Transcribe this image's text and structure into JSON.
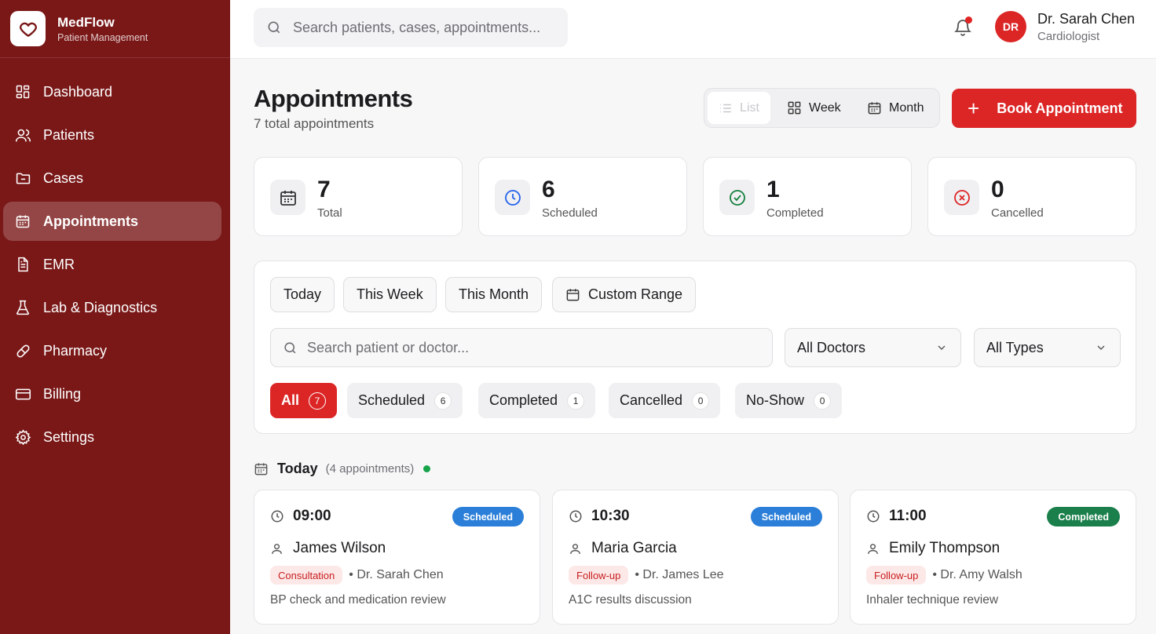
{
  "brand": {
    "name": "MedFlow",
    "subtitle": "Patient Management"
  },
  "sidebar": {
    "items": [
      {
        "label": "Dashboard",
        "icon": "dashboard-icon"
      },
      {
        "label": "Patients",
        "icon": "users-icon"
      },
      {
        "label": "Cases",
        "icon": "folder-icon"
      },
      {
        "label": "Appointments",
        "icon": "calendar-icon",
        "active": true
      },
      {
        "label": "EMR",
        "icon": "document-icon"
      },
      {
        "label": "Lab & Diagnostics",
        "icon": "flask-icon"
      },
      {
        "label": "Pharmacy",
        "icon": "pill-icon"
      },
      {
        "label": "Billing",
        "icon": "credit-card-icon"
      },
      {
        "label": "Settings",
        "icon": "gear-icon"
      }
    ]
  },
  "topbar": {
    "search_placeholder": "Search patients, cases, appointments...",
    "user": {
      "initials": "DR",
      "name": "Dr. Sarah Chen",
      "role": "Cardiologist"
    }
  },
  "header": {
    "title": "Appointments",
    "subtitle": "7 total appointments",
    "views": {
      "list": "List",
      "week": "Week",
      "month": "Month",
      "selected": "List"
    },
    "book_label": "Book Appointment"
  },
  "stats": [
    {
      "value": "7",
      "label": "Total",
      "icon": "calendar-icon",
      "color": "#333333"
    },
    {
      "value": "6",
      "label": "Scheduled",
      "icon": "clock-icon",
      "color": "#2563eb"
    },
    {
      "value": "1",
      "label": "Completed",
      "icon": "check-circle-icon",
      "color": "#15803d"
    },
    {
      "value": "0",
      "label": "Cancelled",
      "icon": "x-circle-icon",
      "color": "#dc2626"
    }
  ],
  "filters": {
    "ranges": [
      "Today",
      "This Week",
      "This Month",
      "Custom Range"
    ],
    "search_placeholder": "Search patient or doctor...",
    "doctor_select": "All Doctors",
    "type_select": "All Types",
    "statuses": [
      {
        "label": "All",
        "count": "7",
        "active": true
      },
      {
        "label": "Scheduled",
        "count": "6"
      },
      {
        "label": "Completed",
        "count": "1"
      },
      {
        "label": "Cancelled",
        "count": "0"
      },
      {
        "label": "No-Show",
        "count": "0"
      }
    ]
  },
  "today": {
    "label": "Today",
    "count": "(4 appointments)"
  },
  "appointments": [
    {
      "time": "09:00",
      "status": "Scheduled",
      "status_color": "#2b7fd9",
      "patient": "James Wilson",
      "type": "Consultation",
      "doctor": "• Dr. Sarah Chen",
      "note": "BP check and medication review"
    },
    {
      "time": "10:30",
      "status": "Scheduled",
      "status_color": "#2b7fd9",
      "patient": "Maria Garcia",
      "type": "Follow-up",
      "doctor": "• Dr. James Lee",
      "note": "A1C results discussion"
    },
    {
      "time": "11:00",
      "status": "Completed",
      "status_color": "#1a7f4b",
      "patient": "Emily Thompson",
      "type": "Follow-up",
      "doctor": "• Dr. Amy Walsh",
      "note": "Inhaler technique review"
    }
  ],
  "colors": {
    "sidebar": "#7a1818",
    "accent": "#dc2626"
  }
}
